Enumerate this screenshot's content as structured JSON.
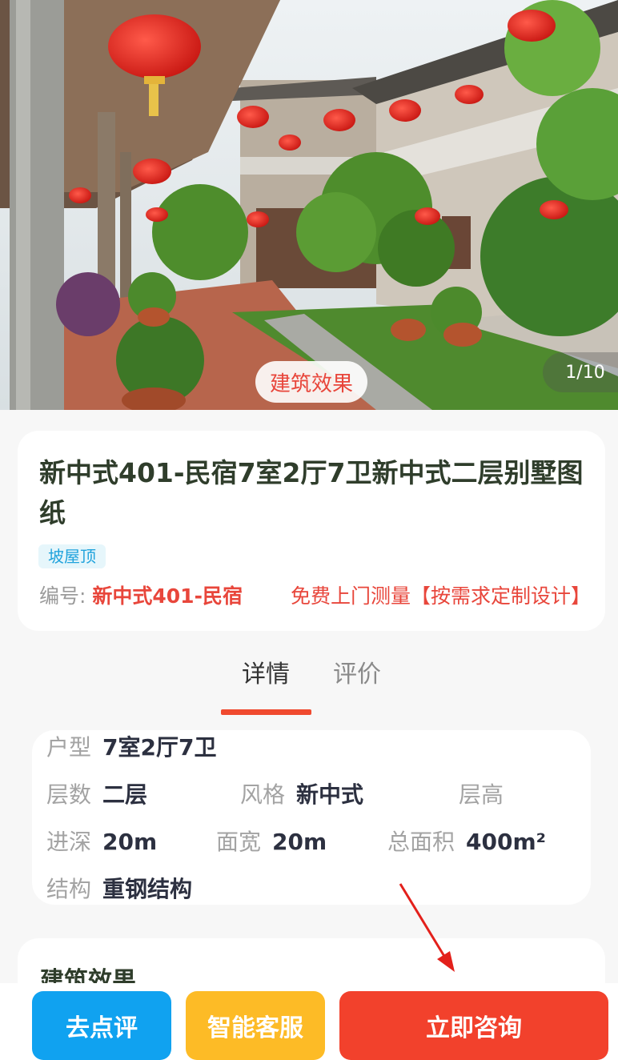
{
  "hero": {
    "tag": "建筑效果",
    "counter": "1/10"
  },
  "product": {
    "title": "新中式401-民宿7室2厅7卫新中式二层别墅图纸",
    "tag": "坡屋顶",
    "code_label": "编号:",
    "code_value": "新中式401-民宿",
    "promo": "免费上门测量【按需求定制设计】"
  },
  "tabs": [
    {
      "label": "详情",
      "active": true
    },
    {
      "label": "评价",
      "active": false
    }
  ],
  "specs": {
    "layout": {
      "label": "户型",
      "value": "7室2厅7卫"
    },
    "floors": {
      "label": "层数",
      "value": "二层"
    },
    "style": {
      "label": "风格",
      "value": "新中式"
    },
    "height": {
      "label": "层高",
      "value": ""
    },
    "depth": {
      "label": "进深",
      "value": "20m"
    },
    "width": {
      "label": "面宽",
      "value": "20m"
    },
    "area": {
      "label": "总面积",
      "value": "400m²"
    },
    "structure": {
      "label": "结构",
      "value": "重钢结构"
    }
  },
  "effect_section": {
    "title": "建筑效果"
  },
  "bottom_bar": {
    "review": "去点评",
    "service": "智能客服",
    "consult": "立即咨询"
  },
  "colors": {
    "accent_red": "#f2412c",
    "review_blue": "#10a2f0",
    "service_yellow": "#fdbb26",
    "tag_blue": "#21a3dc"
  }
}
